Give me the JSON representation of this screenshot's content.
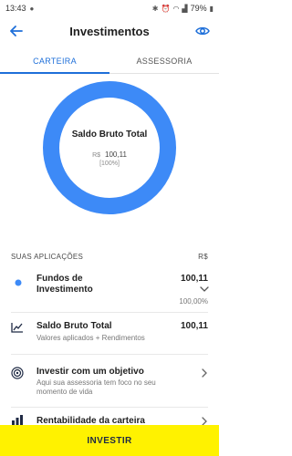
{
  "status_bar": {
    "time": "13:43",
    "battery": "79%"
  },
  "header": {
    "title": "Investimentos"
  },
  "tabs": [
    {
      "label": "CARTEIRA",
      "active": true
    },
    {
      "label": "ASSESSORIA",
      "active": false
    }
  ],
  "summary": {
    "title": "Saldo Bruto Total",
    "currency": "R$",
    "value": "100,11",
    "percent": "[100%]"
  },
  "applications": {
    "header_left": "SUAS APLICAÇÕES",
    "header_right": "R$"
  },
  "items": {
    "funds": {
      "title_line1": "Fundos de",
      "title_line2": "Investimento",
      "value": "100,11",
      "percent": "100,00%"
    },
    "balance": {
      "title": "Saldo Bruto Total",
      "subtitle": "Valores aplicados + Rendimentos",
      "value": "100,11"
    },
    "goal": {
      "title": "Investir com um objetivo",
      "subtitle_line1": "Aqui sua assessoria tem foco no seu",
      "subtitle_line2": "momento de vida"
    },
    "profitability": {
      "title": "Rentabilidade da carteira"
    }
  },
  "bottom_button": {
    "label": "INVESTIR"
  },
  "colors": {
    "accent": "#1e6fd9",
    "donut": "#3d8af7",
    "cta": "#fff200"
  }
}
